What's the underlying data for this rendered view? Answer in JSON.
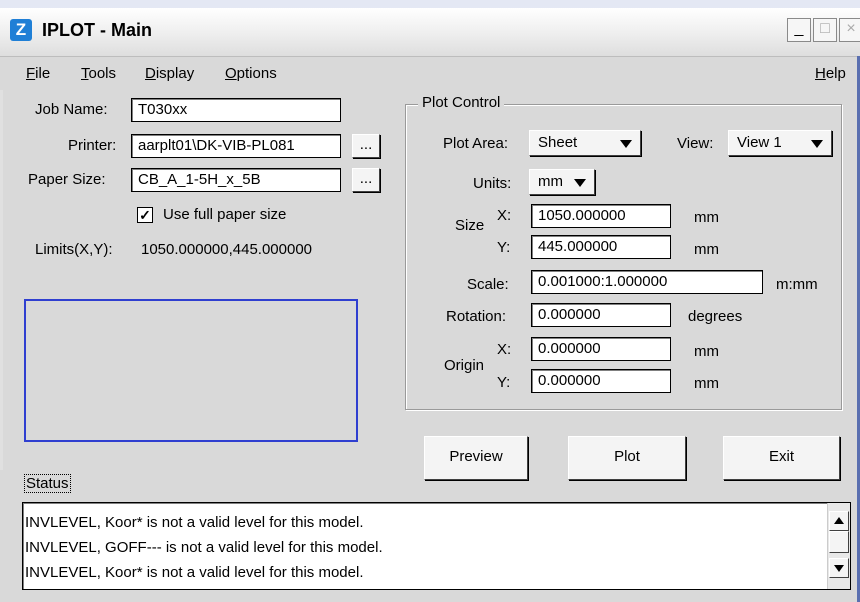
{
  "window": {
    "title": "IPLOT - Main",
    "icon_name": "iplot-app-icon",
    "icon_glyph": "Z",
    "controls": {
      "minimize": "_",
      "maximize": "□",
      "close": "×"
    }
  },
  "menu": {
    "file": "File",
    "tools": "Tools",
    "display": "Display",
    "options": "Options",
    "help": "Help"
  },
  "job": {
    "job_name_label": "Job Name:",
    "job_name_value": "T030xx",
    "printer_label": "Printer:",
    "printer_value": "aarplt01\\DK-VIB-PL081",
    "paper_size_label": "Paper Size:",
    "paper_size_value": "CB_A_1-5H_x_5B",
    "browse_label": "...",
    "use_full_paper_label": "Use full paper size",
    "use_full_paper_checked": true,
    "limits_label": "Limits(X,Y):",
    "limits_value": "1050.000000,445.000000"
  },
  "plot_control": {
    "title": "Plot Control",
    "plot_area_label": "Plot Area:",
    "plot_area_value": "Sheet",
    "view_label": "View:",
    "view_value": "View 1",
    "units_label": "Units:",
    "units_value": "mm",
    "size_label": "Size",
    "x_label": "X:",
    "y_label": "Y:",
    "size_x": "1050.000000",
    "size_y": "445.000000",
    "size_unit": "mm",
    "scale_label": "Scale:",
    "scale_value": "0.001000:1.000000",
    "scale_unit": "m:mm",
    "rotation_label": "Rotation:",
    "rotation_value": "0.000000",
    "rotation_unit": "degrees",
    "origin_label": "Origin",
    "origin_x": "0.000000",
    "origin_y": "0.000000",
    "origin_unit": "mm"
  },
  "buttons": {
    "preview": "Preview",
    "plot": "Plot",
    "exit": "Exit"
  },
  "status": {
    "label": "Status",
    "lines": [
      "INVLEVEL, Koor* is not a valid level for this model.",
      "INVLEVEL, GOFF--- is not a valid level for this model.",
      "INVLEVEL, Koor* is not a valid level for this model."
    ]
  }
}
